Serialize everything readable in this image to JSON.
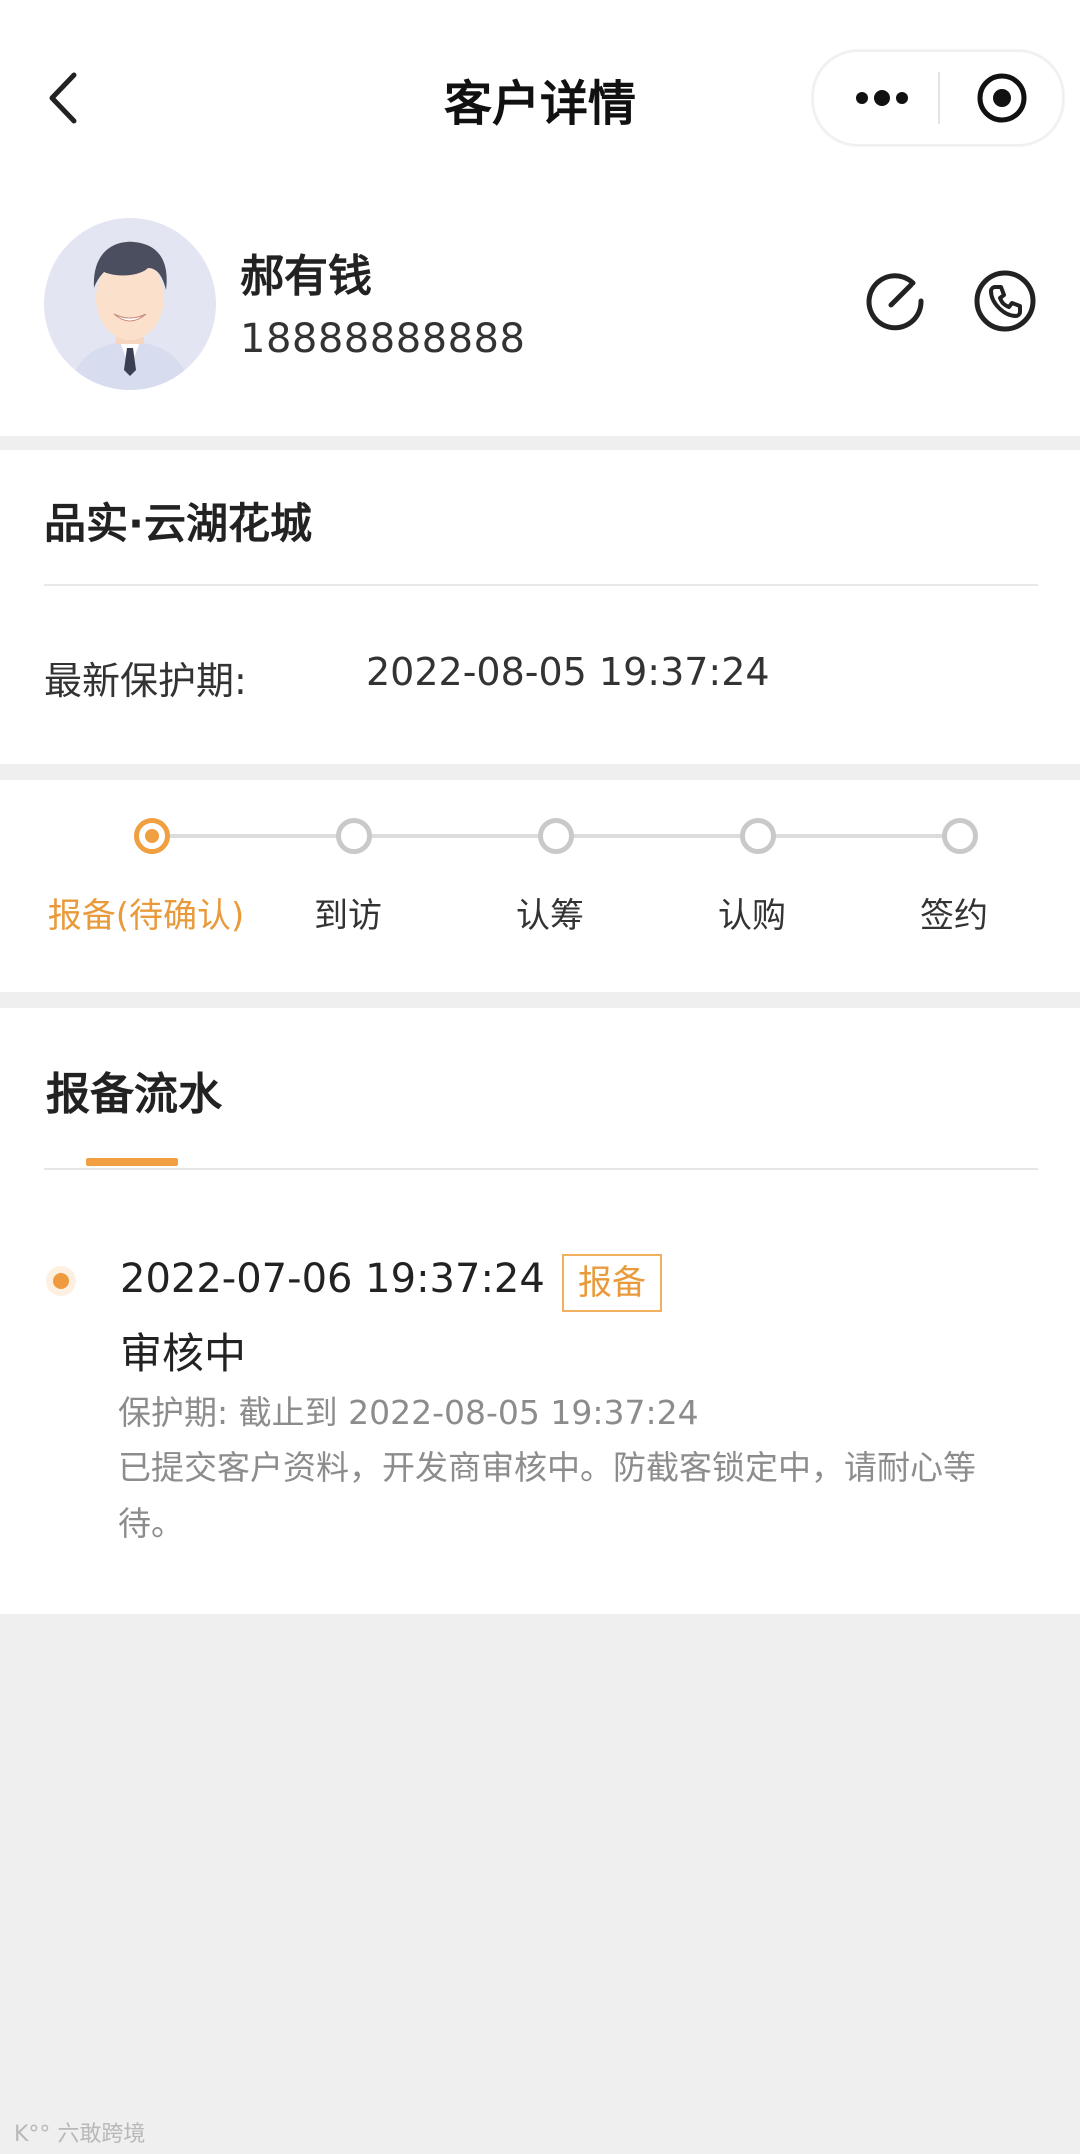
{
  "header": {
    "title": "客户详情",
    "back_icon": "chevron-left-icon",
    "more_icon": "more-dots-icon",
    "target_icon": "target-circle-icon"
  },
  "customer": {
    "name": "郝有钱",
    "phone": "18888888888",
    "edit_icon": "edit-icon",
    "call_icon": "phone-icon"
  },
  "project": {
    "name": "品实·云湖花城",
    "protect_label": "最新保护期:",
    "protect_value": "2022-08-05 19:37:24"
  },
  "steps": [
    {
      "label": "报备(待确认)",
      "active": true
    },
    {
      "label": "到访",
      "active": false
    },
    {
      "label": "认筹",
      "active": false
    },
    {
      "label": "认购",
      "active": false
    },
    {
      "label": "签约",
      "active": false
    }
  ],
  "records": {
    "title": "报备流水",
    "items": [
      {
        "time": "2022-07-06 19:37:24",
        "badge": "报备",
        "status": "审核中",
        "protect": "保护期: 截止到 2022-08-05 19:37:24",
        "desc": "已提交客户资料，开发商审核中。防截客锁定中，请耐心等待。"
      }
    ]
  },
  "colors": {
    "accent": "#F0A040",
    "background": "#EFEFEF"
  },
  "watermark": "K°° 六敢跨境"
}
